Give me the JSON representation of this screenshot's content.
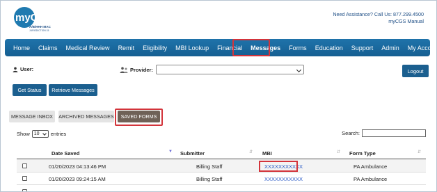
{
  "brand": {
    "logo_text": "myCGS",
    "logo_sub1": "A/B/HHH MAC",
    "logo_sub2": "JURISDICTION 15"
  },
  "help": {
    "line1": "Need Assistance? Call Us: 877.299.4500",
    "line2": "myCGS Manual"
  },
  "nav": {
    "items": [
      "Home",
      "Claims",
      "Medical Review",
      "Remit",
      "Eligibility",
      "MBI Lookup",
      "Financial",
      "Messages",
      "Forms",
      "Education",
      "Support",
      "Admin",
      "My Account"
    ],
    "active": "Messages"
  },
  "user_label": "User:",
  "provider_label": "Provider:",
  "logout_label": "Logout",
  "buttons": {
    "get_status": "Get Status",
    "retrieve": "Retrieve Messages"
  },
  "tabs": {
    "inbox": "MESSAGE INBOX",
    "archived": "ARCHIVED MESSAGES",
    "saved": "SAVED FORMS"
  },
  "table_controls": {
    "show": "Show",
    "entries_value": "10",
    "entries": "entries",
    "search": "Search:"
  },
  "table": {
    "headers": {
      "date": "Date Saved",
      "submitter": "Submitter",
      "mbi": "MBI",
      "form_type": "Form Type"
    },
    "rows": [
      {
        "date": "01/20/2023 04:13:46 PM",
        "submitter": "Billing Staff",
        "mbi": "XXXXXXXXXXX",
        "form_type": "PA Ambulance"
      },
      {
        "date": "01/20/2023 09:24:15 AM",
        "submitter": "Billing Staff",
        "mbi": "XXXXXXXXXXX",
        "form_type": "PA Ambulance"
      }
    ]
  },
  "colors": {
    "nav": "#1a6ba1",
    "button": "#1b5f8f",
    "highlight": "#d3343b",
    "tab_active": "#6f6157"
  }
}
